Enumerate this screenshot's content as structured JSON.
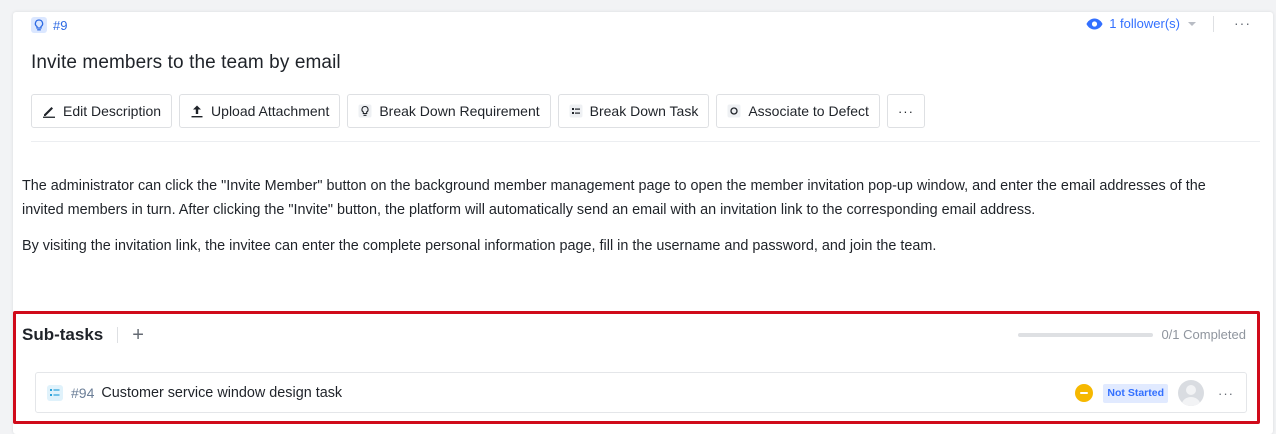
{
  "issue": {
    "id": "#9",
    "title": "Invite members to the team by email",
    "followers_label": "1 follower(s)",
    "more_label": "···"
  },
  "toolbar": {
    "buttons": [
      {
        "label": "Edit Description",
        "icon": "pencil-icon"
      },
      {
        "label": "Upload Attachment",
        "icon": "upload-icon"
      },
      {
        "label": "Break Down Requirement",
        "icon": "lightbulb-icon"
      },
      {
        "label": "Break Down Task",
        "icon": "task-list-icon"
      },
      {
        "label": "Associate to Defect",
        "icon": "defect-icon"
      }
    ],
    "more_label": "···"
  },
  "description": {
    "paragraphs": [
      "The administrator can click the \"Invite Member\" button on the background member management page to open the member invitation pop-up window, and enter the email addresses of the invited members in turn. After clicking the \"Invite\" button, the platform will automatically send an email with an invitation link to the corresponding email address.",
      "By visiting the invitation link, the invitee can enter the complete personal information page, fill in the username and password, and join the team."
    ]
  },
  "subtasks": {
    "title": "Sub-tasks",
    "add_label": "+",
    "progress_text": "0/1 Completed",
    "progress_fraction": 0,
    "items": [
      {
        "id": "#94",
        "title": "Customer service window design task",
        "status": "Not Started",
        "more_label": "···"
      }
    ]
  },
  "colors": {
    "accent": "#3370ff",
    "highlight_outline": "#d00a1a",
    "priority": "#f6b800"
  }
}
